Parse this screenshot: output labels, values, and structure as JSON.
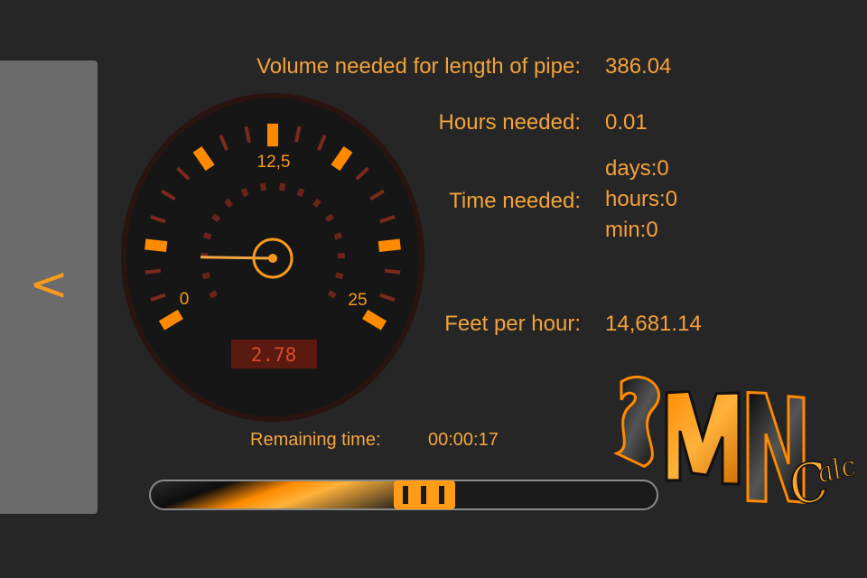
{
  "nav": {
    "back_icon": "chevron-left-icon",
    "back_glyph": "<"
  },
  "results": {
    "volume_label": "Volume needed for length of pipe:",
    "volume_value": "386.04",
    "hours_label": "Hours needed:",
    "hours_value": "0.01",
    "time_label": "Time needed:",
    "time_days": "days:0",
    "time_hours": "hours:0",
    "time_min": "min:0",
    "feet_label": "Feet per hour:",
    "feet_value": "14,681.14"
  },
  "gauge": {
    "min_label": "0",
    "mid_label": "12,5",
    "max_label": "25",
    "min": 0,
    "max": 25,
    "value": 2.78,
    "readout": "2.78"
  },
  "timer": {
    "remaining_label": "Remaining time:",
    "remaining_value": "00:00:17"
  },
  "progress": {
    "fraction": 0.57
  },
  "logo": {
    "text": "SMN Calc"
  },
  "colors": {
    "accent": "#f59a1c",
    "background": "#262626",
    "panel": "#6b6b6b",
    "gauge_face": "#161616"
  }
}
